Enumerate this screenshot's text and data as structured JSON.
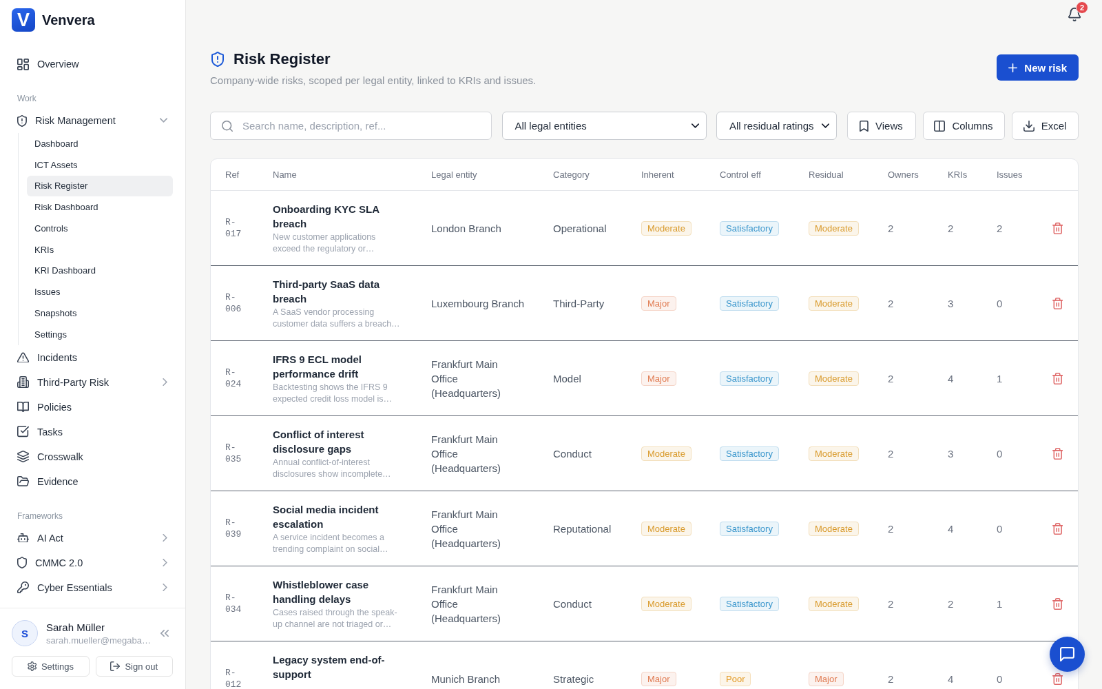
{
  "sidebar": {
    "brand": {
      "logo": "V",
      "name": "Venvera"
    },
    "nav": [
      {
        "kind": "link",
        "label": "Overview",
        "selected": false
      }
    ],
    "sections": [
      {
        "heading": "Work",
        "items": [
          {
            "kind": "group",
            "label": "Risk Management",
            "selected": false,
            "expanded": true,
            "children": [
              {
                "label": "Dashboard",
                "selected": false
              },
              {
                "label": "ICT Assets",
                "selected": false
              },
              {
                "label": "Risk Register",
                "selected": true
              },
              {
                "label": "Risk Dashboard",
                "selected": false
              },
              {
                "label": "Controls",
                "selected": false
              },
              {
                "label": "KRIs",
                "selected": false
              },
              {
                "label": "KRI Dashboard",
                "selected": false
              },
              {
                "label": "Issues",
                "selected": false
              },
              {
                "label": "Snapshots",
                "selected": false
              },
              {
                "label": "Settings",
                "selected": false
              }
            ]
          },
          {
            "kind": "link",
            "label": "Incidents",
            "selected": false
          },
          {
            "kind": "group",
            "label": "Third-Party Risk",
            "selected": false,
            "expanded": false
          },
          {
            "kind": "link",
            "label": "Policies",
            "selected": false
          },
          {
            "kind": "link",
            "label": "Tasks",
            "selected": false
          },
          {
            "kind": "link",
            "label": "Crosswalk",
            "selected": false
          },
          {
            "kind": "link",
            "label": "Evidence",
            "selected": false
          }
        ]
      },
      {
        "heading": "Frameworks",
        "items": [
          {
            "kind": "group",
            "label": "AI Act",
            "selected": false,
            "expanded": false
          },
          {
            "kind": "group",
            "label": "CMMC 2.0",
            "selected": false,
            "expanded": false
          },
          {
            "kind": "group",
            "label": "Cyber Essentials",
            "selected": false,
            "expanded": false
          }
        ]
      }
    ],
    "user": {
      "initial": "S",
      "name": "Sarah Müller",
      "email": "sarah.mueller@megaba…"
    },
    "buttons": [
      "Settings",
      "Sign out"
    ]
  },
  "notifications": {
    "count": "2"
  },
  "page": {
    "title": "Risk Register",
    "subtitle": "Company-wide risks, scoped per legal entity, linked to KRIs and issues.",
    "new_button": "New risk"
  },
  "toolbar": {
    "search": {
      "placeholder": "Search name, description, ref..."
    },
    "filters": [
      "All legal entities",
      "All residual ratings"
    ],
    "buttons": [
      "Views",
      "Columns",
      "Excel"
    ]
  },
  "table": {
    "columns": [
      "Ref",
      "Name",
      "Legal entity",
      "Category",
      "Inherent",
      "Control eff",
      "Residual",
      "Owners",
      "KRIs",
      "Issues"
    ],
    "rows": [
      {
        "ref": "R-017",
        "name": "Onboarding KYC SLA breach",
        "description": "New customer applications exceed the regulatory or…",
        "legal_entity": "London Branch",
        "category": "Operational",
        "inherent": {
          "label": "Moderate",
          "color": "#d99a2b"
        },
        "control_eff": {
          "label": "Satisfactory",
          "color": "#3a96cc"
        },
        "residual": {
          "label": "Moderate",
          "color": "#d99a2b"
        },
        "owners": "2",
        "kris": "2",
        "issues": "2"
      },
      {
        "ref": "R-006",
        "name": "Third-party SaaS data breach",
        "description": "A SaaS vendor processing customer data suffers a breach…",
        "legal_entity": "Luxembourg Branch",
        "category": "Third-Party",
        "inherent": {
          "label": "Major",
          "color": "#e07a50"
        },
        "control_eff": {
          "label": "Satisfactory",
          "color": "#3a96cc"
        },
        "residual": {
          "label": "Moderate",
          "color": "#d99a2b"
        },
        "owners": "2",
        "kris": "3",
        "issues": "0"
      },
      {
        "ref": "R-024",
        "name": "IFRS 9 ECL model performance drift",
        "description": "Backtesting shows the IFRS 9 expected credit loss model is…",
        "legal_entity": "Frankfurt Main Office (Headquarters)",
        "category": "Model",
        "inherent": {
          "label": "Major",
          "color": "#e07a50"
        },
        "control_eff": {
          "label": "Satisfactory",
          "color": "#3a96cc"
        },
        "residual": {
          "label": "Moderate",
          "color": "#d99a2b"
        },
        "owners": "2",
        "kris": "4",
        "issues": "1"
      },
      {
        "ref": "R-035",
        "name": "Conflict of interest disclosure gaps",
        "description": "Annual conflict-of-interest disclosures show incomplete…",
        "legal_entity": "Frankfurt Main Office (Headquarters)",
        "category": "Conduct",
        "inherent": {
          "label": "Moderate",
          "color": "#d99a2b"
        },
        "control_eff": {
          "label": "Satisfactory",
          "color": "#3a96cc"
        },
        "residual": {
          "label": "Moderate",
          "color": "#d99a2b"
        },
        "owners": "2",
        "kris": "3",
        "issues": "0"
      },
      {
        "ref": "R-039",
        "name": "Social media incident escalation",
        "description": "A service incident becomes a trending complaint on social…",
        "legal_entity": "Frankfurt Main Office (Headquarters)",
        "category": "Reputational",
        "inherent": {
          "label": "Moderate",
          "color": "#d99a2b"
        },
        "control_eff": {
          "label": "Satisfactory",
          "color": "#3a96cc"
        },
        "residual": {
          "label": "Moderate",
          "color": "#d99a2b"
        },
        "owners": "2",
        "kris": "4",
        "issues": "0"
      },
      {
        "ref": "R-034",
        "name": "Whistleblower case handling delays",
        "description": "Cases raised through the speak-up channel are not triaged or…",
        "legal_entity": "Frankfurt Main Office (Headquarters)",
        "category": "Conduct",
        "inherent": {
          "label": "Moderate",
          "color": "#d99a2b"
        },
        "control_eff": {
          "label": "Satisfactory",
          "color": "#3a96cc"
        },
        "residual": {
          "label": "Moderate",
          "color": "#d99a2b"
        },
        "owners": "2",
        "kris": "2",
        "issues": "1"
      },
      {
        "ref": "R-012",
        "name": "Legacy system end-of-support",
        "legal_entity": "Munich Branch",
        "category": "Strategic",
        "inherent": {
          "label": "Major",
          "color": "#e07a50"
        },
        "control_eff": {
          "label": "Poor",
          "color": "#e39b26"
        },
        "residual": {
          "label": "Major",
          "color": "#e07a50"
        },
        "owners": "2",
        "kris": "4",
        "issues": "0"
      }
    ]
  }
}
